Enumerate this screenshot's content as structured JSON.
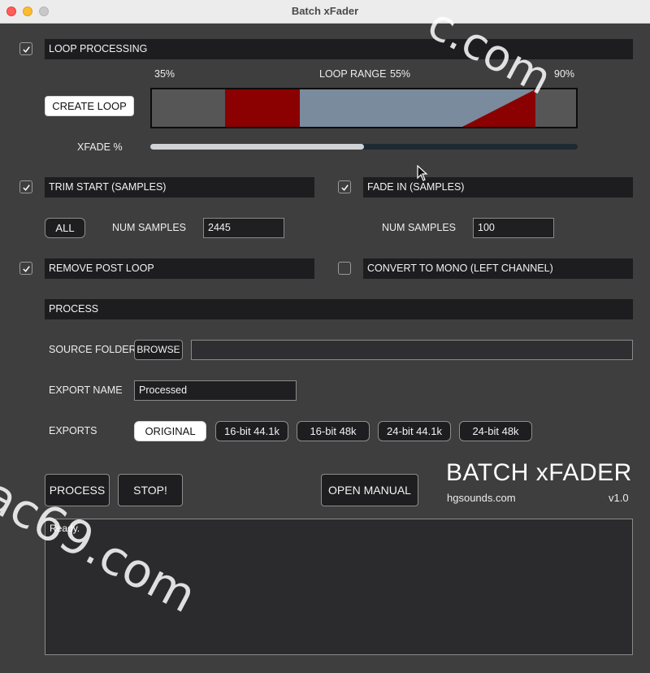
{
  "window": {
    "title": "Batch xFader"
  },
  "loop": {
    "section_label": "LOOP PROCESSING",
    "checked": true,
    "create_button": "CREATE LOOP",
    "range_label": "LOOP RANGE",
    "start_label": "35%",
    "mid_label": "55%",
    "end_label": "90%",
    "start_fraction": 0.35,
    "mid_fraction": 0.55,
    "end_fraction": 0.9,
    "xfade_label": "XFADE %",
    "xfade_fraction": 0.5,
    "colors": {
      "region": "#8b0000",
      "middle": "#7a8b9e",
      "outside": "#565656"
    }
  },
  "trim": {
    "section_label": "TRIM START (SAMPLES)",
    "checked": true,
    "all_button": "ALL",
    "num_samples_label": "NUM SAMPLES",
    "num_samples_value": "2445"
  },
  "fade": {
    "section_label": "FADE IN (SAMPLES)",
    "checked": true,
    "num_samples_label": "NUM SAMPLES",
    "num_samples_value": "100"
  },
  "remove_post_loop": {
    "label": "REMOVE POST LOOP",
    "checked": true
  },
  "mono": {
    "label": "CONVERT TO MONO (LEFT CHANNEL)",
    "checked": false
  },
  "process_section": {
    "section_label": "PROCESS",
    "source_folder_label": "SOURCE FOLDER",
    "browse_button": "BROWSE",
    "source_folder_value": "",
    "export_name_label": "EXPORT NAME",
    "export_name_value": "Processed",
    "exports_label": "EXPORTS",
    "export_options": [
      "ORIGINAL",
      "16-bit 44.1k",
      "16-bit 48k",
      "24-bit 44.1k",
      "24-bit 48k"
    ],
    "export_selected": "ORIGINAL"
  },
  "actions": {
    "process_button": "PROCESS",
    "stop_button": "STOP!",
    "manual_button": "OPEN MANUAL"
  },
  "brand": {
    "name": "BATCH xFADER",
    "site": "hgsounds.com",
    "version": "v1.0"
  },
  "log": {
    "text": "Ready."
  },
  "watermarks": [
    "ac69.com",
    "c.com"
  ]
}
